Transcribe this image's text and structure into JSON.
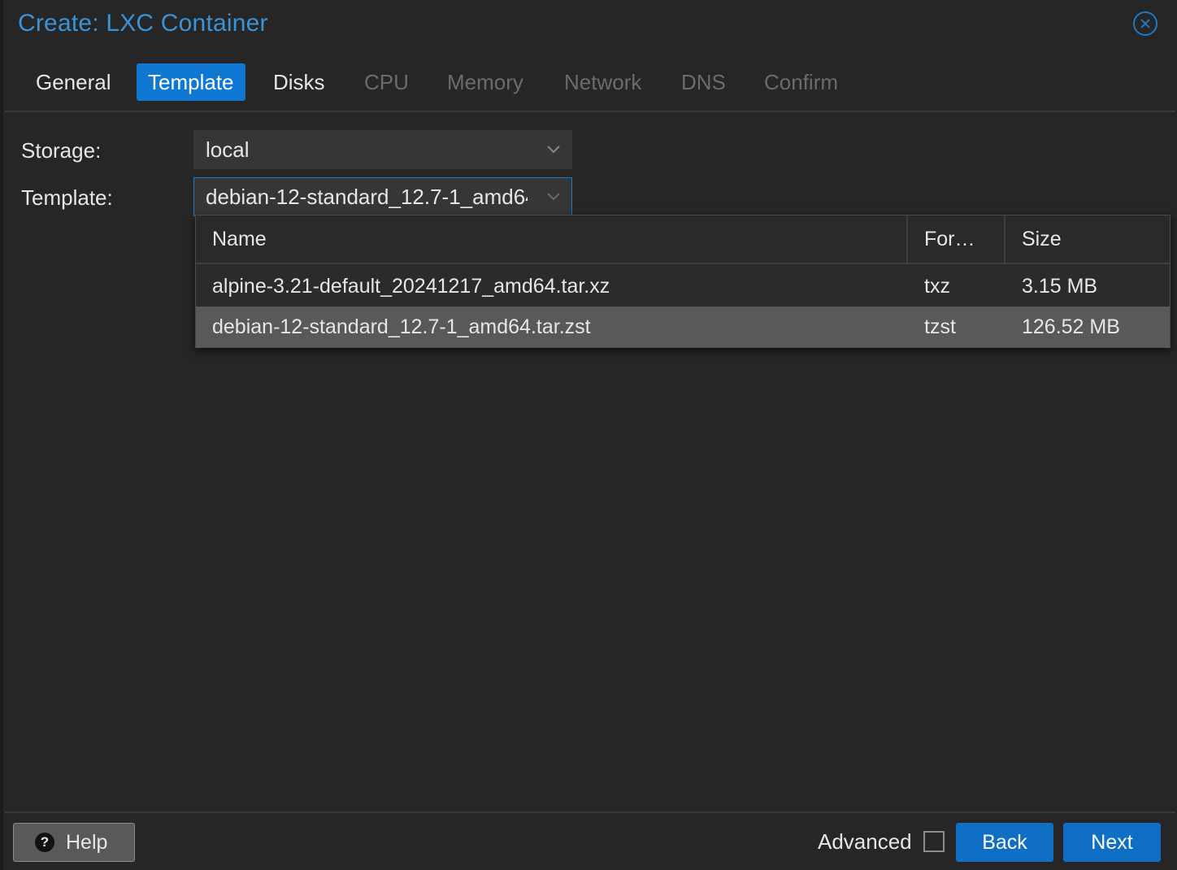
{
  "dialog": {
    "title": "Create: LXC Container"
  },
  "tabs": [
    {
      "label": "General",
      "state": "normal"
    },
    {
      "label": "Template",
      "state": "active"
    },
    {
      "label": "Disks",
      "state": "normal"
    },
    {
      "label": "CPU",
      "state": "disabled"
    },
    {
      "label": "Memory",
      "state": "disabled"
    },
    {
      "label": "Network",
      "state": "disabled"
    },
    {
      "label": "DNS",
      "state": "disabled"
    },
    {
      "label": "Confirm",
      "state": "disabled"
    }
  ],
  "form": {
    "storage_label": "Storage:",
    "storage_value": "local",
    "template_label": "Template:",
    "template_value": "debian-12-standard_12.7-1_amd64.tar.zst"
  },
  "template_grid": {
    "columns": [
      "Name",
      "For…",
      "Size"
    ],
    "rows": [
      {
        "name": "alpine-3.21-default_20241217_amd64.tar.xz",
        "format": "txz",
        "size": "3.15 MB",
        "selected": false
      },
      {
        "name": "debian-12-standard_12.7-1_amd64.tar.zst",
        "format": "tzst",
        "size": "126.52 MB",
        "selected": true
      }
    ]
  },
  "footer": {
    "help_label": "Help",
    "advanced_label": "Advanced",
    "advanced_checked": false,
    "back_label": "Back",
    "next_label": "Next"
  },
  "colors": {
    "accent": "#0f78d2",
    "title": "#3a93d6",
    "background": "#262626",
    "selected_row": "#595959"
  },
  "icons": {
    "close": "close-circle-icon",
    "help": "question-circle-icon",
    "combo": "chevron-down-icon"
  }
}
